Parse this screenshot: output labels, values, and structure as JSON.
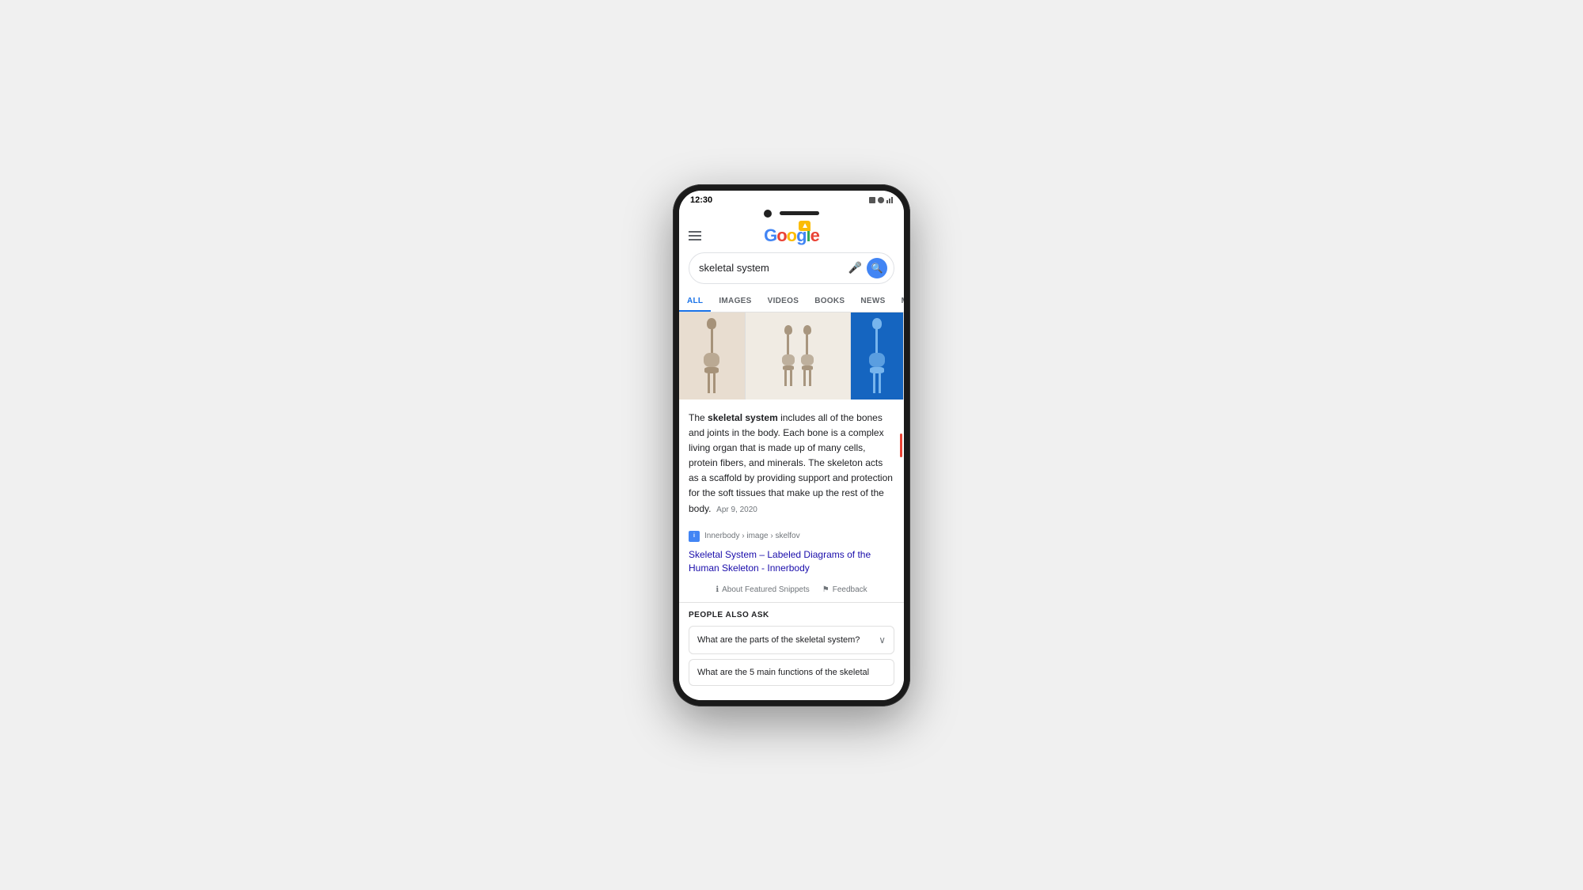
{
  "phone": {
    "status_time": "12:30"
  },
  "header": {
    "logo": {
      "g1": "G",
      "o1": "o",
      "o2": "o",
      "g2": "g",
      "l": "l",
      "e": "e"
    },
    "hamburger_label": "Menu"
  },
  "search": {
    "query": "skeletal system",
    "placeholder": "skeletal system",
    "mic_label": "Voice Search",
    "search_label": "Search"
  },
  "tabs": [
    {
      "id": "all",
      "label": "ALL",
      "active": true
    },
    {
      "id": "images",
      "label": "IMAGES",
      "active": false
    },
    {
      "id": "videos",
      "label": "VIDEOS",
      "active": false
    },
    {
      "id": "books",
      "label": "BOOKS",
      "active": false
    },
    {
      "id": "news",
      "label": "NEWS",
      "active": false
    },
    {
      "id": "maps",
      "label": "MAP",
      "active": false
    }
  ],
  "featured_snippet": {
    "intro": "The ",
    "bold_term": "skeletal system",
    "body": " includes all of the bones and joints in the body. Each bone is a complex living organ that is made up of many cells, protein fibers, and minerals. The skeleton acts as a scaffold by providing support and protection for the soft tissues that make up the rest of the body.",
    "date": "Apr 9, 2020",
    "source_path": "Innerbody › image › skelfov",
    "source_link": "Skeletal System – Labeled Diagrams of the Human Skeleton - Innerbody",
    "about_snippets": "About Featured Snippets",
    "feedback": "Feedback"
  },
  "people_also_ask": {
    "title": "PEOPLE ALSO ASK",
    "questions": [
      {
        "text": "What are the parts of the skeletal system?",
        "expanded": false
      },
      {
        "text": "What are the 5 main functions of the skeletal",
        "partial": true
      }
    ]
  }
}
